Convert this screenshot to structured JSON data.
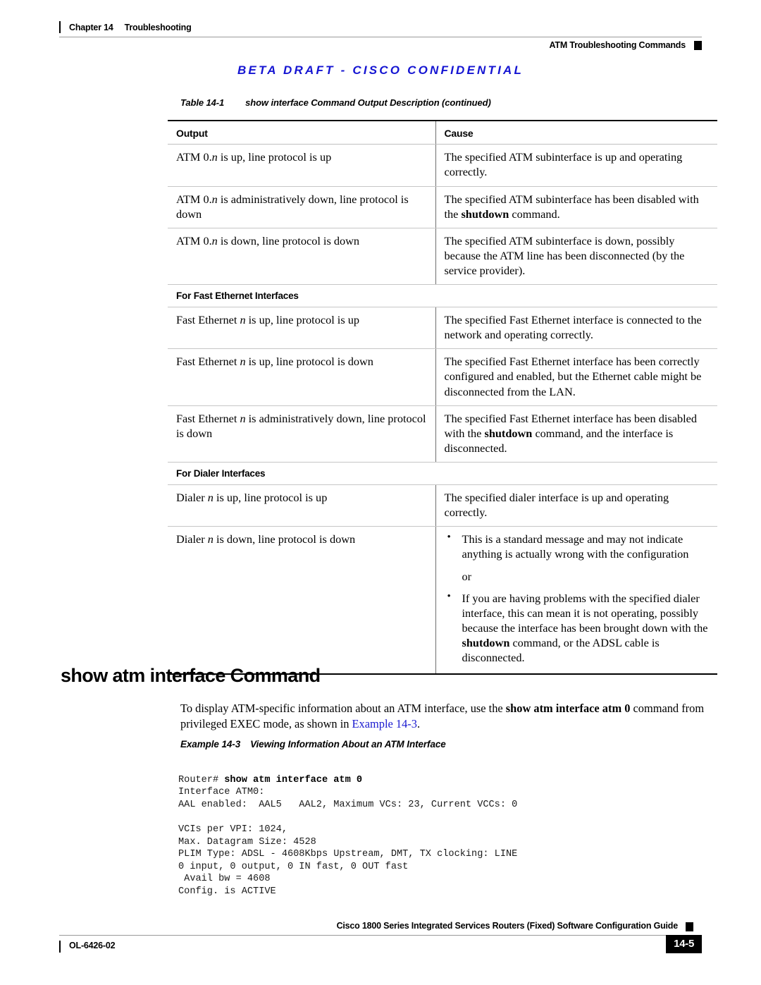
{
  "header": {
    "chapter": "Chapter 14",
    "chapter_title": "Troubleshooting",
    "section_right": "ATM Troubleshooting Commands"
  },
  "banner": {
    "text": "BETA DRAFT - CISCO CONFIDENTIAL",
    "color": "#1414d2"
  },
  "table": {
    "caption_number": "Table 14-1",
    "caption_text": "show interface Command Output Description (continued)",
    "columns": [
      "Output",
      "Cause"
    ],
    "rows": [
      {
        "type": "data",
        "output_html": "ATM 0.<i>n</i> is up, line protocol is up",
        "cause_html": "The specified ATM subinterface is up and operating correctly."
      },
      {
        "type": "data",
        "output_html": "ATM 0.<i>n</i> is administratively down, line protocol is down",
        "cause_html": "The specified ATM subinterface has been disabled with the <b>shutdown</b> command."
      },
      {
        "type": "data",
        "output_html": "ATM 0.<i>n</i> is down, line protocol is down",
        "cause_html": "The specified ATM subinterface is down, possibly because the ATM line has been disconnected (by the service provider)."
      },
      {
        "type": "subhead",
        "label": "For Fast Ethernet Interfaces"
      },
      {
        "type": "data",
        "output_html": "Fast Ethernet <i>n</i> is up, line protocol is up",
        "cause_html": "The specified Fast Ethernet interface is connected to the network and operating correctly."
      },
      {
        "type": "data",
        "output_html": "Fast Ethernet <i>n</i> is up, line protocol is down",
        "cause_html": "The specified Fast Ethernet interface has been correctly configured and enabled, but the Ethernet cable might be disconnected from the LAN."
      },
      {
        "type": "data",
        "output_html": "Fast Ethernet <i>n</i> is administratively down, line protocol is down",
        "cause_html": "The specified Fast Ethernet interface has been disabled with the <b>shutdown</b> command, and the interface is disconnected."
      },
      {
        "type": "subhead",
        "label": "For Dialer Interfaces"
      },
      {
        "type": "data",
        "output_html": "Dialer <i>n</i> is up, line protocol is up",
        "cause_html": "The specified dialer interface is up and operating correctly."
      },
      {
        "type": "data-last",
        "output_html": "Dialer <i>n</i> is down, line protocol is down",
        "cause_html": "<ul class=\"bul-list\"><li>This is a standard message and may not indicate anything is actually wrong with the configuration</li></ul><div class=\"bul-or\">or</div><ul class=\"bul-list\"><li>If you are having problems with the specified dialer interface, this can mean it is not operating, possibly because the interface has been brought down with the <b>shutdown</b> command, or the ADSL cable is disconnected.</li></ul>"
      }
    ]
  },
  "section": {
    "heading": "show atm interface Command",
    "paragraph_html": "To display ATM-specific information about an ATM interface, use the <b>show atm interface atm 0</b> command from privileged EXEC mode, as shown in <span class=\"xref\">Example&nbsp;14-3</span>.",
    "xref_label": "Example 14-3",
    "xref_color": "#1a1ad0"
  },
  "example": {
    "caption_number": "Example 14-3",
    "caption_text": "Viewing Information About an ATM Interface",
    "code_html": "Router# <b>show atm interface atm 0</b>\nInterface ATM0:\nAAL enabled:  AAL5   AAL2, Maximum VCs: 23, Current VCCs: 0\n\nVCIs per VPI: 1024,\nMax. Datagram Size: 4528\nPLIM Type: ADSL - 4608Kbps Upstream, DMT, TX clocking: LINE\n0 input, 0 output, 0 IN fast, 0 OUT fast\n Avail bw = 4608\nConfig. is ACTIVE",
    "code_lines": [
      "Router# show atm interface atm 0",
      "Interface ATM0:",
      "AAL enabled:  AAL5   AAL2, Maximum VCs: 23, Current VCCs: 0",
      "",
      "VCIs per VPI: 1024,",
      "Max. Datagram Size: 4528",
      "PLIM Type: ADSL - 4608Kbps Upstream, DMT, TX clocking: LINE",
      "0 input, 0 output, 0 IN fast, 0 OUT fast",
      " Avail bw = 4608",
      "Config. is ACTIVE"
    ]
  },
  "footer": {
    "doc_title": "Cisco 1800 Series Integrated Services Routers (Fixed) Software Configuration Guide",
    "doc_id": "OL-6426-02",
    "page_number": "14-5"
  }
}
